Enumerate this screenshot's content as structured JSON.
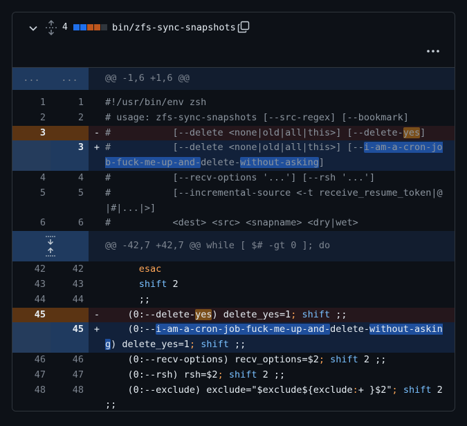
{
  "file": {
    "changes_count": "4",
    "path": "bin/zfs-sync-snapshots",
    "diffstat": [
      "#1f6feb",
      "#1f6feb",
      "#bd561d",
      "#bd561d",
      "#30363d"
    ]
  },
  "hunks": [
    {
      "header": "@@ -1,6 +1,6 @@",
      "expand_left": "...",
      "expand_right": "..."
    },
    {
      "header": "@@ -42,7 +42,7 @@ while [ $# -gt 0 ]; do"
    }
  ],
  "lines": {
    "l1": {
      "old": "1",
      "new": "1",
      "text": "#!/usr/bin/env zsh"
    },
    "l2": {
      "old": "2",
      "new": "2",
      "text": "# usage: zfs-sync-snapshots [--src-regex] [--bookmark]"
    },
    "l3": {
      "old": "3",
      "sign": "-",
      "a": "#           [--delete <none|old|all|this>] [--delete-",
      "b": "yes",
      "c": "]"
    },
    "l3n": {
      "new": "3",
      "sign": "+",
      "a": "#           [--delete <none|old|all|this>] [--",
      "b": "i-am-a-cron-job-fuck-me-up-and-",
      "c": "delete-",
      "d": "without-asking",
      "e": "]"
    },
    "l4": {
      "old": "4",
      "new": "4",
      "text": "#           [--recv-options '...'] [--rsh '...']"
    },
    "l5": {
      "old": "5",
      "new": "5",
      "text": "#           [--incremental-source <-t receive_resume_token|@|#|...|>]"
    },
    "l6": {
      "old": "6",
      "new": "6",
      "text": "#           <dest> <src> <snapname> <dry|wet>"
    },
    "l42": {
      "old": "42",
      "new": "42",
      "text": "esac"
    },
    "l43": {
      "old": "43",
      "new": "43",
      "kw": "shift",
      "rest": " 2"
    },
    "l44": {
      "old": "44",
      "new": "44",
      "text": ";;"
    },
    "l45": {
      "old": "45",
      "sign": "-",
      "a": "(0:--delete-",
      "b": "yes",
      "c": ") delete_yes=1",
      "d": ";",
      "e": "shift",
      "f": " ;;"
    },
    "l45n": {
      "new": "45",
      "sign": "+",
      "a": "(0:--",
      "b": "i-am-a-cron-job-fuck-me-up-and-",
      "c": "delete-",
      "d": "without-asking",
      "e": ") delete_yes=1",
      "f": ";",
      "g": "shift",
      "h": " ;;"
    },
    "l46": {
      "old": "46",
      "new": "46",
      "a": "(0:--recv-options) recv_options=$2",
      "b": ";",
      "c": "shift",
      "d": " 2 ;;"
    },
    "l47": {
      "old": "47",
      "new": "47",
      "a": "(0:--rsh) rsh=$2",
      "b": ";",
      "c": "shift",
      "d": " 2 ;;"
    },
    "l48": {
      "old": "48",
      "new": "48",
      "a": "(0:--exclude) exclude=\"$exclude${exclude",
      "b": ":",
      "c": "+ }$2\"",
      "d": ";",
      "e": "shift",
      "f": " 2 ;;"
    }
  }
}
